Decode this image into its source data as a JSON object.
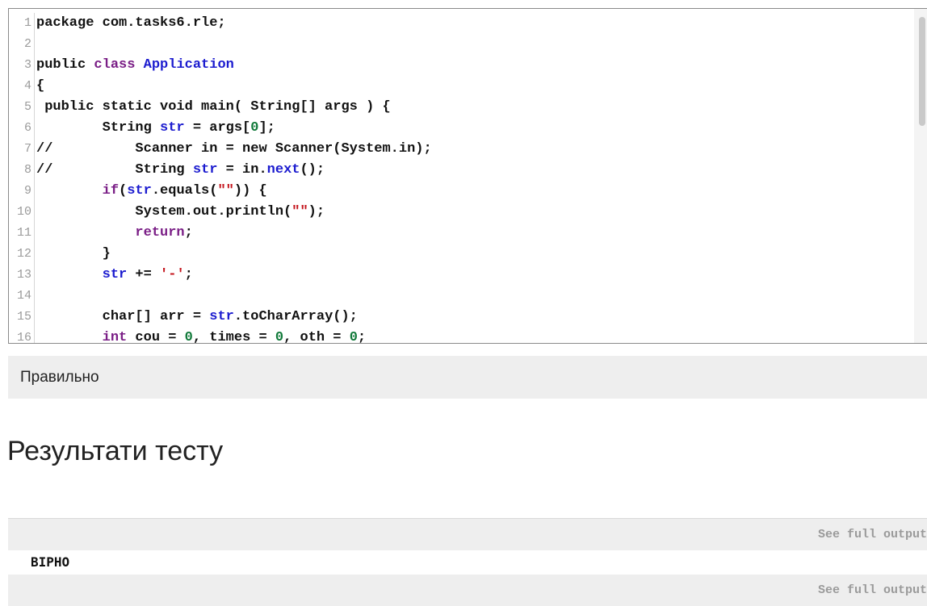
{
  "code_editor": {
    "lines": [
      {
        "number": "1",
        "tokens": [
          {
            "text": "package com.tasks6.rle;",
            "type": "plain"
          }
        ]
      },
      {
        "number": "2",
        "tokens": []
      },
      {
        "number": "3",
        "tokens": [
          {
            "text": "public ",
            "type": "plain"
          },
          {
            "text": "class",
            "type": "kw"
          },
          {
            "text": " ",
            "type": "plain"
          },
          {
            "text": "Application",
            "type": "def"
          }
        ]
      },
      {
        "number": "4",
        "tokens": [
          {
            "text": "{",
            "type": "plain"
          }
        ]
      },
      {
        "number": "5",
        "tokens": [
          {
            "text": " public static void main( String[] args ) {",
            "type": "plain"
          }
        ]
      },
      {
        "number": "6",
        "tokens": [
          {
            "text": "        String ",
            "type": "plain"
          },
          {
            "text": "str",
            "type": "var"
          },
          {
            "text": " = args[",
            "type": "plain"
          },
          {
            "text": "0",
            "type": "num"
          },
          {
            "text": "];",
            "type": "plain"
          }
        ]
      },
      {
        "number": "7",
        "tokens": [
          {
            "text": "//          Scanner in = new Scanner(System.in);",
            "type": "plain"
          }
        ]
      },
      {
        "number": "8",
        "tokens": [
          {
            "text": "//          String ",
            "type": "plain"
          },
          {
            "text": "str",
            "type": "var"
          },
          {
            "text": " = in.",
            "type": "plain"
          },
          {
            "text": "next",
            "type": "var"
          },
          {
            "text": "();",
            "type": "plain"
          }
        ]
      },
      {
        "number": "9",
        "tokens": [
          {
            "text": "        ",
            "type": "plain"
          },
          {
            "text": "if",
            "type": "kw"
          },
          {
            "text": "(",
            "type": "plain"
          },
          {
            "text": "str",
            "type": "var"
          },
          {
            "text": ".equals(",
            "type": "plain"
          },
          {
            "text": "\"\"",
            "type": "str"
          },
          {
            "text": ")) {",
            "type": "plain"
          }
        ]
      },
      {
        "number": "10",
        "tokens": [
          {
            "text": "            System.out.println(",
            "type": "plain"
          },
          {
            "text": "\"\"",
            "type": "str"
          },
          {
            "text": ");",
            "type": "plain"
          }
        ]
      },
      {
        "number": "11",
        "tokens": [
          {
            "text": "            ",
            "type": "plain"
          },
          {
            "text": "return",
            "type": "kw"
          },
          {
            "text": ";",
            "type": "plain"
          }
        ]
      },
      {
        "number": "12",
        "tokens": [
          {
            "text": "        }",
            "type": "plain"
          }
        ]
      },
      {
        "number": "13",
        "tokens": [
          {
            "text": "        ",
            "type": "plain"
          },
          {
            "text": "str",
            "type": "var"
          },
          {
            "text": " += ",
            "type": "plain"
          },
          {
            "text": "'-'",
            "type": "str"
          },
          {
            "text": ";",
            "type": "plain"
          }
        ]
      },
      {
        "number": "14",
        "tokens": []
      },
      {
        "number": "15",
        "tokens": [
          {
            "text": "        char[] arr = ",
            "type": "plain"
          },
          {
            "text": "str",
            "type": "var"
          },
          {
            "text": ".toCharArray();",
            "type": "plain"
          }
        ]
      },
      {
        "number": "16",
        "tokens": [
          {
            "text": "        ",
            "type": "plain"
          },
          {
            "text": "int",
            "type": "kw"
          },
          {
            "text": " cou = ",
            "type": "plain"
          },
          {
            "text": "0",
            "type": "num"
          },
          {
            "text": ", times = ",
            "type": "plain"
          },
          {
            "text": "0",
            "type": "num"
          },
          {
            "text": ", oth = ",
            "type": "plain"
          },
          {
            "text": "0",
            "type": "num"
          },
          {
            "text": ";",
            "type": "plain"
          }
        ]
      }
    ],
    "colors": {
      "keyword": "#7a1e86",
      "definition": "#1c1ccf",
      "number": "#117a3a",
      "string": "#c4141c"
    }
  },
  "feedback": {
    "text": "Правильно"
  },
  "results": {
    "heading": "Результати тесту",
    "rows": [
      {
        "kind": "output_link",
        "label": "See full output"
      },
      {
        "kind": "value",
        "text": "ВІРНО"
      },
      {
        "kind": "output_link",
        "label": "See full output"
      }
    ]
  }
}
